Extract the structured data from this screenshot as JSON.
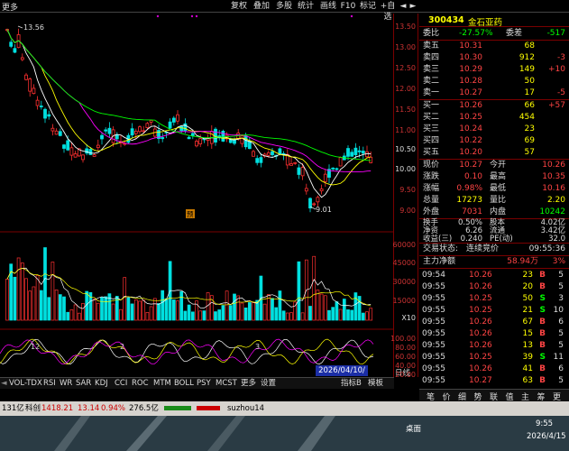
{
  "toolbar": {
    "more_label": "更多",
    "buttons": [
      "复权",
      "叠加",
      "多股",
      "统计",
      "画线",
      "F10",
      "标记",
      "+自选"
    ],
    "left_arrow": "◄",
    "right_arrow": "►"
  },
  "chart": {
    "high_marker": "13.56",
    "low_marker": "9.01",
    "flag_label": "预",
    "price_ticks": [
      "13.50",
      "13.00",
      "12.50",
      "12.00",
      "11.50",
      "11.00",
      "10.50",
      "10.00",
      "9.50",
      "9.00"
    ],
    "price_ticks_white": [
      "10.50",
      "10.00"
    ],
    "vol_ticks": [
      "60000",
      "45000",
      "30000",
      "15000",
      "X10"
    ],
    "macd_ticks": [
      "100.00",
      "80.00",
      "60.00",
      "40.00",
      "20.00"
    ],
    "date_badge": "2026/04/10/五",
    "timeline_label": "日线",
    "month_labels": [
      "12",
      "2",
      "3"
    ],
    "colors": {
      "up": "#ff3030",
      "down": "#00e0e0",
      "ma5": "#ffffff",
      "ma10": "#ffff00",
      "ma20": "#ff00ff",
      "ma60": "#00ff00"
    }
  },
  "indicator_tabs": [
    "VOL-TDX",
    "RSI",
    "WR",
    "SAR",
    "KDJ",
    "CCI",
    "ROC",
    "MTM",
    "BOLL",
    "PSY",
    "MCST",
    "更多",
    "设置"
  ],
  "indicator_extra": [
    "指标B",
    "模板"
  ],
  "stock": {
    "code": "300434",
    "name": "金石亚药",
    "weibi_label": "委比",
    "weibi": "-27.57%",
    "weicha_label": "委差",
    "weicha": "-517",
    "asks": [
      {
        "label": "卖五",
        "price": "10.31",
        "qty": "68",
        "chg": ""
      },
      {
        "label": "卖四",
        "price": "10.30",
        "qty": "912",
        "chg": "-3"
      },
      {
        "label": "卖三",
        "price": "10.29",
        "qty": "149",
        "chg": "+10"
      },
      {
        "label": "卖二",
        "price": "10.28",
        "qty": "50",
        "chg": ""
      },
      {
        "label": "卖一",
        "price": "10.27",
        "qty": "17",
        "chg": "-5"
      }
    ],
    "bids": [
      {
        "label": "买一",
        "price": "10.26",
        "qty": "66",
        "chg": "+57"
      },
      {
        "label": "买二",
        "price": "10.25",
        "qty": "454",
        "chg": ""
      },
      {
        "label": "买三",
        "price": "10.24",
        "qty": "23",
        "chg": ""
      },
      {
        "label": "买四",
        "price": "10.22",
        "qty": "69",
        "chg": ""
      },
      {
        "label": "买五",
        "price": "10.20",
        "qty": "57",
        "chg": ""
      }
    ],
    "quote": [
      {
        "l1": "现价",
        "v1": "10.27",
        "l2": "今开",
        "v2": "10.26"
      },
      {
        "l1": "涨跌",
        "v1": "0.10",
        "l2": "最高",
        "v2": "10.35"
      },
      {
        "l1": "涨幅",
        "v1": "0.98%",
        "l2": "最低",
        "v2": "10.16"
      },
      {
        "l1": "总量",
        "v1": "17273",
        "l2": "量比",
        "v2": "2.20"
      },
      {
        "l1": "外盘",
        "v1": "7031",
        "l2": "内盘",
        "v2": "10242"
      }
    ],
    "stats": [
      {
        "l1": "换手",
        "v1": "0.50%",
        "l2": "股本",
        "v2": "4.02亿"
      },
      {
        "l1": "净资",
        "v1": "6.26",
        "l2": "流通",
        "v2": "3.42亿"
      },
      {
        "l1": "收益(三)",
        "v1": "0.240",
        "l2": "PE(动)",
        "v2": "32.0"
      }
    ],
    "trade_status_label": "交易状态:",
    "trade_status": "连续竞价",
    "trade_time": "09:55:36",
    "main_flow_label": "主力净额",
    "main_flow": "58.94万",
    "main_flow_pct": "3%"
  },
  "trades": [
    {
      "t": "09:54",
      "p": "10.26",
      "q": "23",
      "d": "B",
      "pct": "5"
    },
    {
      "t": "09:55",
      "p": "10.26",
      "q": "20",
      "d": "B",
      "pct": "5"
    },
    {
      "t": "09:55",
      "p": "10.25",
      "q": "50",
      "d": "S",
      "pct": "3"
    },
    {
      "t": "09:55",
      "p": "10.25",
      "q": "21",
      "d": "S",
      "pct": "10"
    },
    {
      "t": "09:55",
      "p": "10.26",
      "q": "67",
      "d": "B",
      "pct": "6"
    },
    {
      "t": "09:55",
      "p": "10.26",
      "q": "15",
      "d": "B",
      "pct": "5"
    },
    {
      "t": "09:55",
      "p": "10.26",
      "q": "13",
      "d": "B",
      "pct": "5"
    },
    {
      "t": "09:55",
      "p": "10.25",
      "q": "39",
      "d": "S",
      "pct": "11"
    },
    {
      "t": "09:55",
      "p": "10.26",
      "q": "41",
      "d": "B",
      "pct": "6"
    },
    {
      "t": "09:55",
      "p": "10.27",
      "q": "63",
      "d": "B",
      "pct": "5"
    }
  ],
  "panel_tabs": [
    "笔",
    "价",
    "细",
    "势",
    "联",
    "值",
    "主",
    "筹",
    "更"
  ],
  "status": {
    "left": "131亿",
    "idx_name": "科创",
    "idx_value": "1418.21",
    "idx_chg": "13.14",
    "idx_pct": "0.94%",
    "idx_amt": "276.5亿",
    "user": "suzhou14"
  },
  "taskbar": {
    "desktop": "桌面",
    "time": "9:55",
    "date": "2026/4/15"
  }
}
